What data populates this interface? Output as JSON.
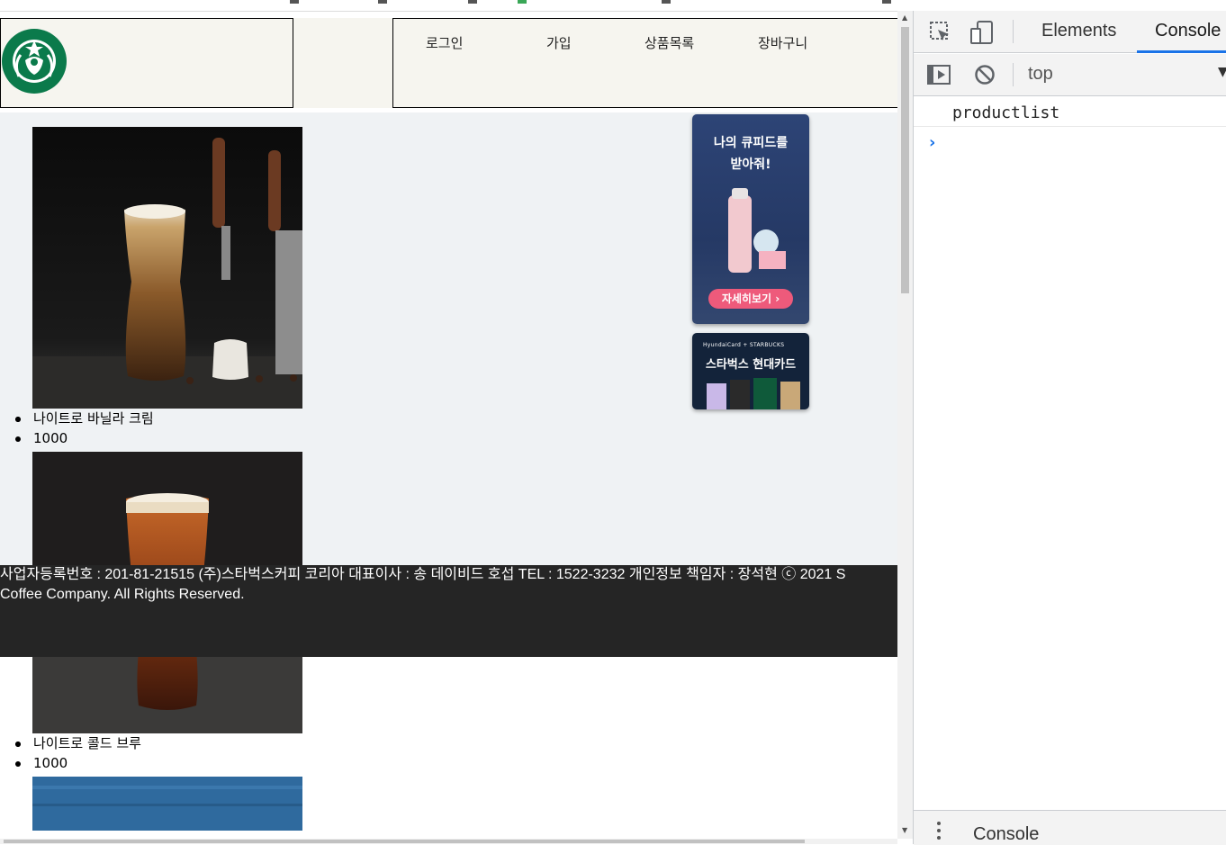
{
  "nav": {
    "items": [
      {
        "label": "로그인"
      },
      {
        "label": "가입"
      },
      {
        "label": "상품목록"
      },
      {
        "label": "장바구니"
      }
    ]
  },
  "products": [
    {
      "name": "나이트로 바닐라 크림",
      "price": "1000"
    },
    {
      "name": "나이트로 콜드 브루",
      "price": "1000"
    }
  ],
  "ads": {
    "ad1": {
      "title_line1": "나의 큐피드를",
      "title_line2": "받아줘!",
      "button": "자세히보기 ›"
    },
    "ad2": {
      "subtitle": "HyundaiCard + STARBUCKS",
      "title": "스타벅스 현대카드"
    }
  },
  "footer": {
    "line1": "사업자등록번호 : 201-81-21515 (주)스타벅스커피 코리아 대표이사 : 송 데이비드 호섭 TEL : 1522-3232 개인정보 책임자 : 장석현 ⓒ 2021 S",
    "line2": "Coffee Company. All Rights Reserved."
  },
  "devtools": {
    "tabs": [
      {
        "label": "Elements"
      },
      {
        "label": "Console"
      }
    ],
    "active_tab": "Console",
    "context": "top",
    "console_log": "productlist",
    "drawer_label": "Console",
    "accent": "#1a73e8"
  },
  "icons": [
    "starbucks-logo",
    "inspect-icon",
    "device-toolbar-icon",
    "run-icon",
    "clear-console-icon",
    "chevron-down-icon",
    "prompt-chevron-icon",
    "more-icon"
  ],
  "colors": {
    "header_bg": "#f6f5ef",
    "main_bg": "#eff2f4",
    "footer_bg": "#252525"
  }
}
